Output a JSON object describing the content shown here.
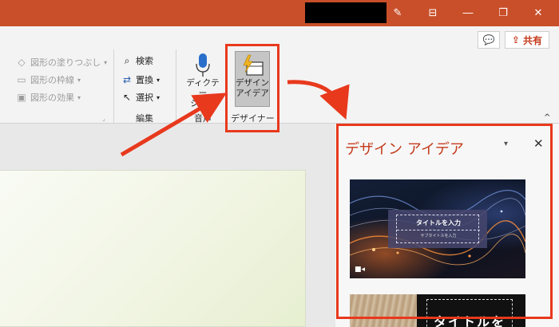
{
  "colors": {
    "accent": "#c43b1c",
    "titlebar": "#c94f2a",
    "annotation": "#e8391d"
  },
  "titlebar": {
    "icons": [
      "pen-icon",
      "window-restore-small-icon",
      "restore-icon",
      "close-icon"
    ],
    "pen_glyph": "✎",
    "box_glyph": "⊟",
    "restore_glyph": "❐",
    "close_glyph": "✕"
  },
  "topright": {
    "comment_glyph": "💬",
    "share_label": "共有",
    "share_glyph": "⇪"
  },
  "ribbon": {
    "shape_fill": "図形の塗りつぶし",
    "shape_outline": "図形の枠線",
    "shape_effects": "図形の効果",
    "find": "検索",
    "replace": "置換",
    "select": "選択",
    "edit_group": "編集",
    "dictate_line1": "ディクテー",
    "dictate_line2": "ション",
    "voice_group": "音声",
    "designer_line1": "デザイン",
    "designer_line2": "アイデア",
    "designer_group": "デザイナー",
    "collapse_glyph": "^"
  },
  "design_pane": {
    "title": "デザイン アイデア",
    "dropdown_glyph": "▾",
    "close_glyph": "✕",
    "thumbnails": [
      {
        "title": "タイトルを入力",
        "subtitle": "サブタイトルを入力",
        "video_glyph": "■◂"
      },
      {
        "title": "タイトルを"
      }
    ]
  }
}
